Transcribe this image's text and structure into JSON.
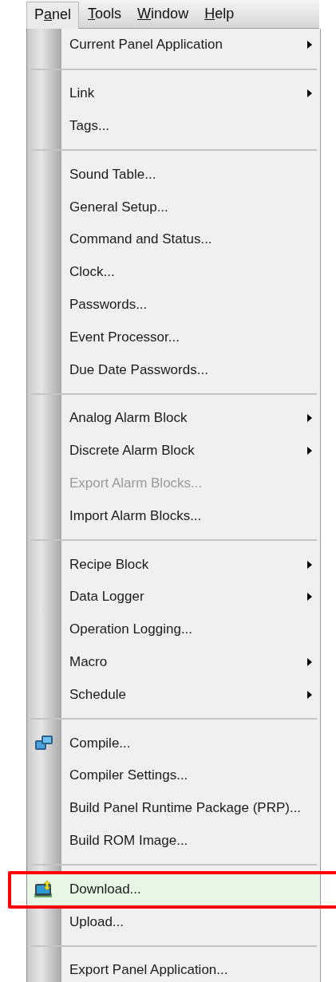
{
  "menu_bar": [
    {
      "before": "P",
      "key": "a",
      "after": "nel",
      "selected": true
    },
    {
      "key": "T",
      "after": "ools",
      "selected": false
    },
    {
      "key": "W",
      "after": "indow",
      "selected": false
    },
    {
      "key": "H",
      "after": "elp",
      "selected": false
    }
  ],
  "menu": {
    "groups": [
      {
        "items": [
          {
            "kind": "text",
            "label": "Current Panel Application",
            "submenu": true,
            "disabled": false,
            "highlighted": false,
            "outlined": false
          }
        ]
      },
      {
        "items": [
          {
            "kind": "text",
            "label": "Link",
            "submenu": true,
            "disabled": false,
            "highlighted": false,
            "outlined": false
          },
          {
            "kind": "text",
            "label": "Tags...",
            "submenu": false,
            "disabled": false,
            "highlighted": false,
            "outlined": false
          }
        ]
      },
      {
        "items": [
          {
            "kind": "text",
            "label": "Sound Table...",
            "submenu": false,
            "disabled": false,
            "highlighted": false,
            "outlined": false
          },
          {
            "kind": "text",
            "label": "General Setup...",
            "submenu": false,
            "disabled": false,
            "highlighted": false,
            "outlined": false
          },
          {
            "kind": "text",
            "label": "Command and Status...",
            "submenu": false,
            "disabled": false,
            "highlighted": false,
            "outlined": false
          },
          {
            "kind": "text",
            "label": "Clock...",
            "submenu": false,
            "disabled": false,
            "highlighted": false,
            "outlined": false
          },
          {
            "kind": "text",
            "label": "Passwords...",
            "submenu": false,
            "disabled": false,
            "highlighted": false,
            "outlined": false
          },
          {
            "kind": "text",
            "label": "Event Processor...",
            "submenu": false,
            "disabled": false,
            "highlighted": false,
            "outlined": false
          },
          {
            "kind": "text",
            "label": "Due Date Passwords...",
            "submenu": false,
            "disabled": false,
            "highlighted": false,
            "outlined": false
          }
        ]
      },
      {
        "items": [
          {
            "kind": "text",
            "label": "Analog Alarm Block",
            "submenu": true,
            "disabled": false,
            "highlighted": false,
            "outlined": false
          },
          {
            "kind": "text",
            "label": "Discrete Alarm Block",
            "submenu": true,
            "disabled": false,
            "highlighted": false,
            "outlined": false
          },
          {
            "kind": "text",
            "label": "Export Alarm Blocks...",
            "submenu": false,
            "disabled": true,
            "highlighted": false,
            "outlined": false
          },
          {
            "kind": "text",
            "label": "Import Alarm Blocks...",
            "submenu": false,
            "disabled": false,
            "highlighted": false,
            "outlined": false
          }
        ]
      },
      {
        "items": [
          {
            "kind": "text",
            "label": "Recipe Block",
            "submenu": true,
            "disabled": false,
            "highlighted": false,
            "outlined": false
          },
          {
            "kind": "text",
            "label": "Data Logger",
            "submenu": true,
            "disabled": false,
            "highlighted": false,
            "outlined": false
          },
          {
            "kind": "text",
            "label": "Operation Logging...",
            "submenu": false,
            "disabled": false,
            "highlighted": false,
            "outlined": false
          },
          {
            "kind": "text",
            "label": "Macro",
            "submenu": true,
            "disabled": false,
            "highlighted": false,
            "outlined": false
          },
          {
            "kind": "text",
            "label": "Schedule",
            "submenu": true,
            "disabled": false,
            "highlighted": false,
            "outlined": false
          }
        ]
      },
      {
        "items": [
          {
            "kind": "compile",
            "label": "Compile...",
            "submenu": false,
            "disabled": false,
            "highlighted": false,
            "outlined": false
          },
          {
            "kind": "text",
            "label": "Compiler Settings...",
            "submenu": false,
            "disabled": false,
            "highlighted": false,
            "outlined": false
          },
          {
            "kind": "text",
            "label": "Build Panel Runtime Package (PRP)...",
            "submenu": false,
            "disabled": false,
            "highlighted": false,
            "outlined": false
          },
          {
            "kind": "text",
            "label": "Build ROM Image...",
            "submenu": false,
            "disabled": false,
            "highlighted": false,
            "outlined": false
          }
        ]
      },
      {
        "items": [
          {
            "kind": "transfer",
            "label": "Download...",
            "submenu": false,
            "disabled": false,
            "highlighted": true,
            "outlined": true
          },
          {
            "kind": "text",
            "label": "Upload...",
            "submenu": false,
            "disabled": false,
            "highlighted": false,
            "outlined": false
          }
        ]
      },
      {
        "items": [
          {
            "kind": "text",
            "label": "Export Panel Application...",
            "submenu": false,
            "disabled": false,
            "highlighted": false,
            "outlined": false
          }
        ]
      }
    ]
  }
}
